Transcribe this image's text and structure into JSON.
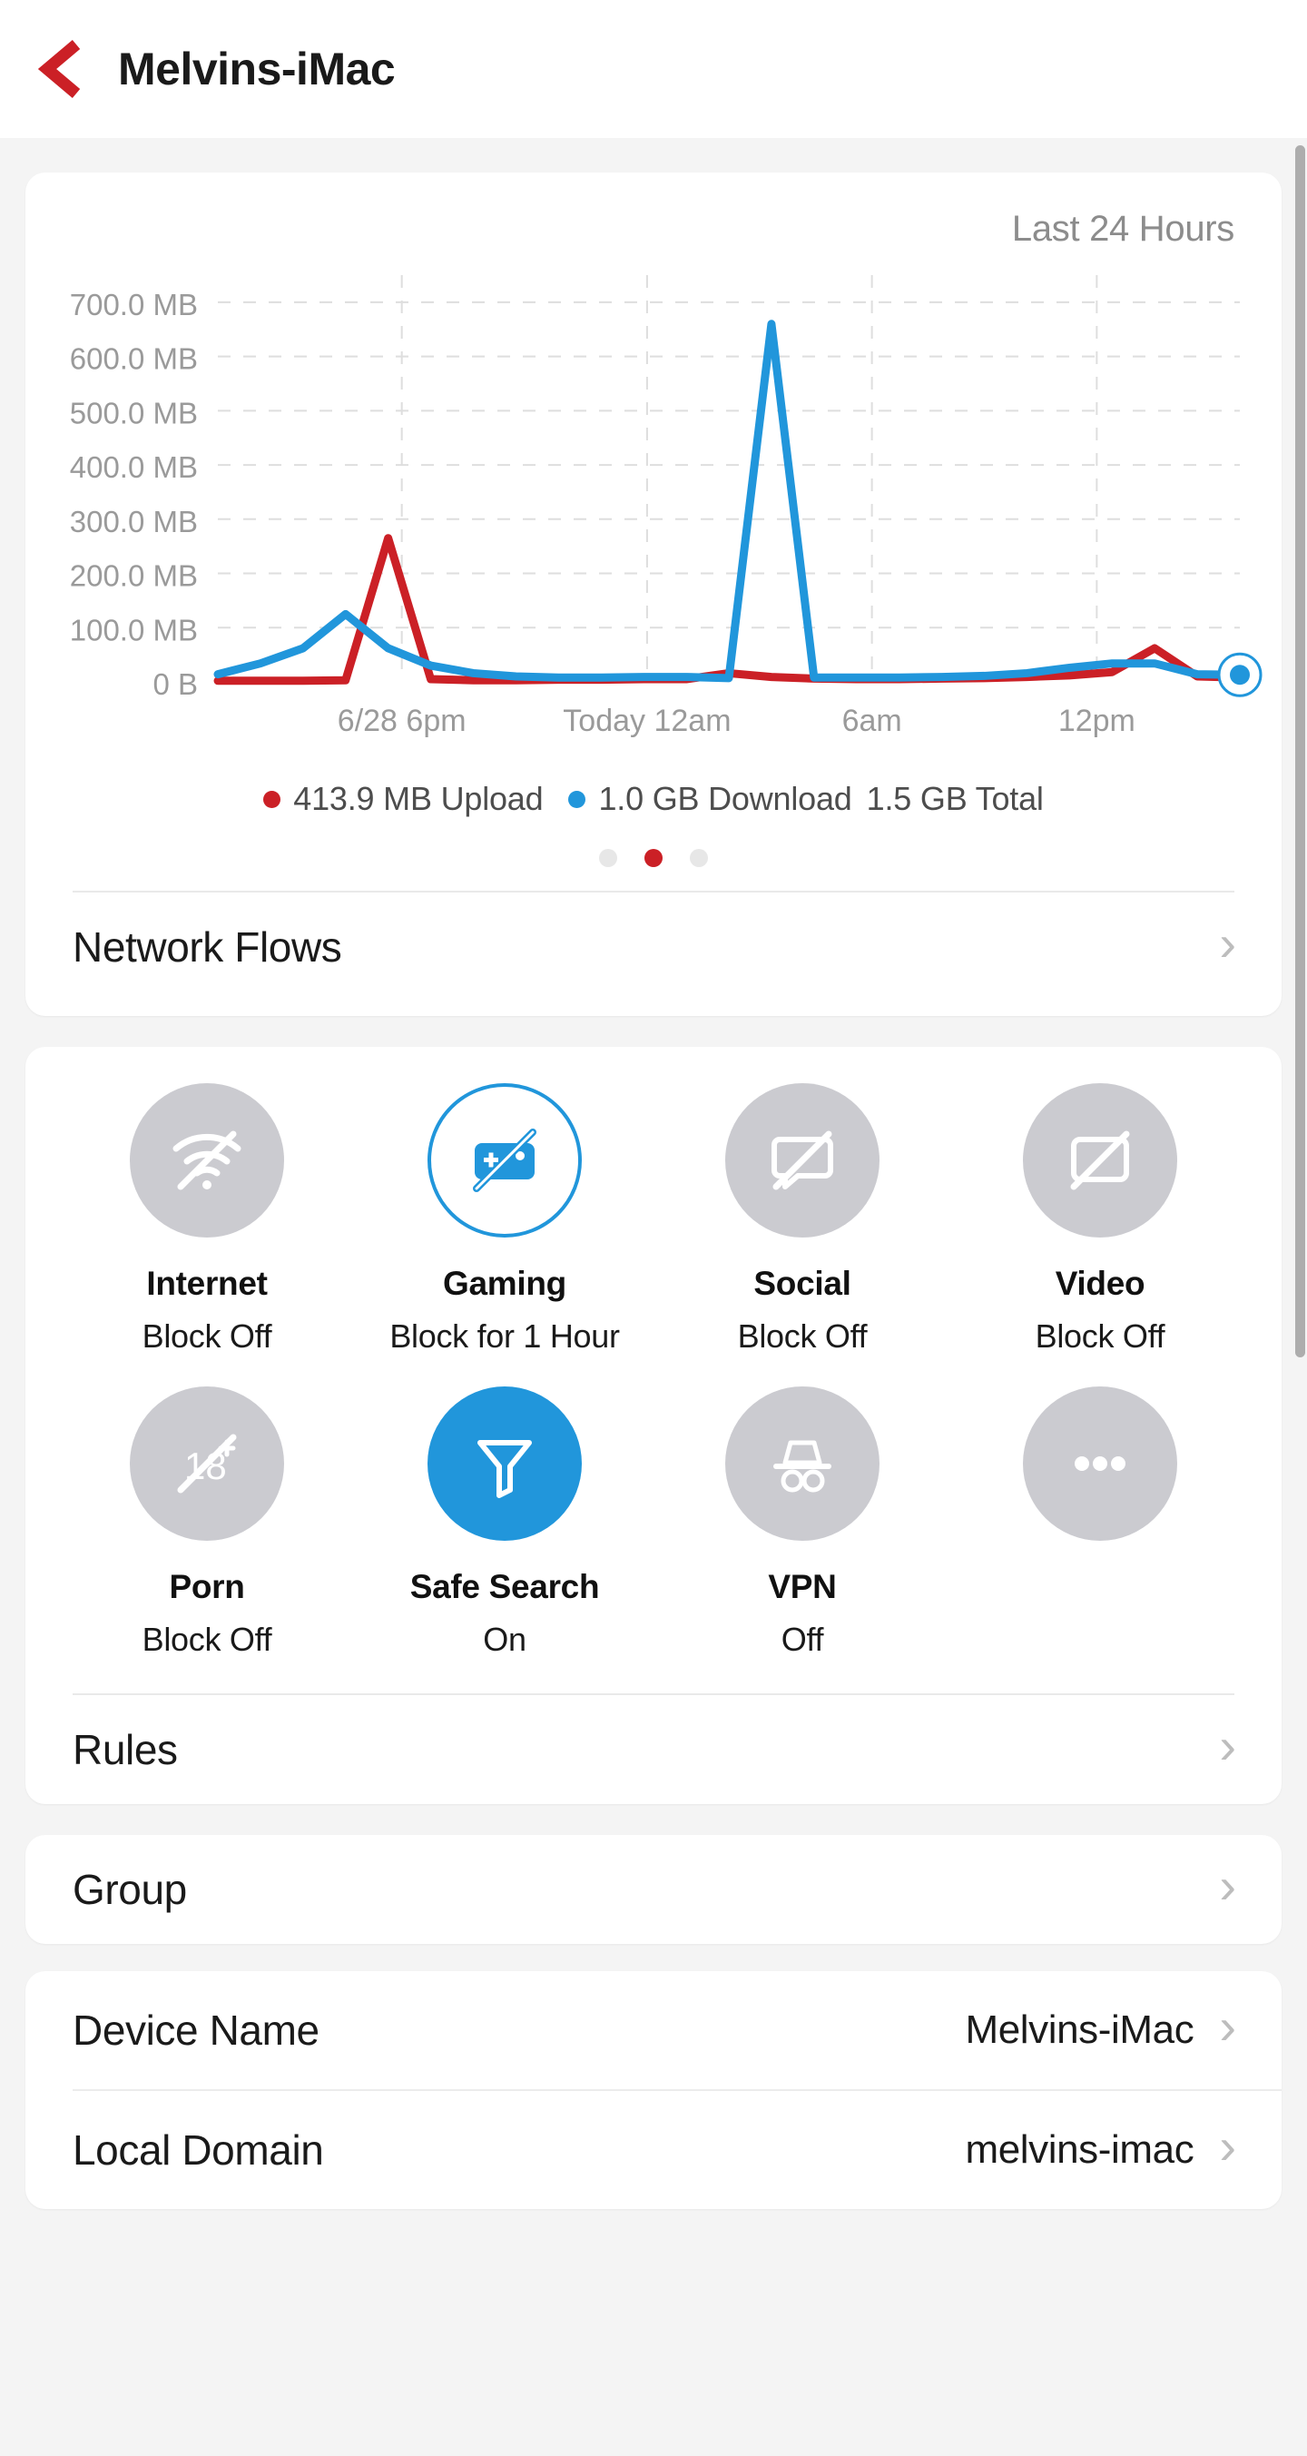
{
  "header": {
    "back_icon": "chevron-left-icon",
    "title": "Melvins-iMac",
    "accent": "#cb2026"
  },
  "chart_card": {
    "range_label": "Last 24 Hours",
    "legend": {
      "upload": "413.9 MB Upload",
      "download": "1.0 GB Download",
      "total": "1.5 GB Total",
      "upload_color": "#cb2026",
      "download_color": "#2196db"
    },
    "pager": {
      "count": 3,
      "active_index": 1
    },
    "network_flows_label": "Network Flows"
  },
  "chart_data": {
    "type": "line",
    "title": "Last 24 Hours",
    "xlabel": "",
    "ylabel": "",
    "grid": true,
    "legend_position": "bottom",
    "ylim": [
      0,
      750
    ],
    "y_unit": "MB",
    "ytick_labels": [
      "700.0 MB",
      "600.0 MB",
      "500.0 MB",
      "400.0 MB",
      "300.0 MB",
      "200.0 MB",
      "100.0 MB",
      "0 B"
    ],
    "ytick_values": [
      700,
      600,
      500,
      400,
      300,
      200,
      100,
      0
    ],
    "xtick_labels": [
      "6/28 6pm",
      "Today 12am",
      "6am",
      "12pm"
    ],
    "xtick_positions": [
      0.18,
      0.42,
      0.64,
      0.86
    ],
    "x": [
      0,
      1,
      2,
      3,
      4,
      5,
      6,
      7,
      8,
      9,
      10,
      11,
      12,
      13,
      14,
      15,
      16,
      17,
      18,
      19,
      20,
      21,
      22,
      23,
      24
    ],
    "series": [
      {
        "name": "Upload",
        "color": "#cb2026",
        "values": [
          2,
          2,
          2,
          3,
          265,
          5,
          3,
          3,
          4,
          4,
          5,
          5,
          16,
          9,
          6,
          5,
          5,
          6,
          7,
          9,
          12,
          18,
          62,
          10,
          8
        ]
      },
      {
        "name": "Download",
        "color": "#2196db",
        "values": [
          14,
          34,
          62,
          125,
          62,
          30,
          16,
          10,
          8,
          8,
          9,
          9,
          7,
          660,
          8,
          8,
          8,
          9,
          11,
          16,
          26,
          34,
          34,
          14,
          13
        ]
      }
    ],
    "end_marker": {
      "series": "Download",
      "color": "#2196db"
    }
  },
  "controls_card": {
    "items": [
      {
        "title": "Internet",
        "status": "Block Off",
        "icon": "wifi-off-icon",
        "state": "inactive"
      },
      {
        "title": "Gaming",
        "status": "Block for 1 Hour",
        "icon": "gamepad-off-icon",
        "state": "outlined"
      },
      {
        "title": "Social",
        "status": "Block Off",
        "icon": "chat-off-icon",
        "state": "inactive"
      },
      {
        "title": "Video",
        "status": "Block Off",
        "icon": "video-off-icon",
        "state": "inactive"
      },
      {
        "title": "Porn",
        "status": "Block Off",
        "icon": "adult-18-off-icon",
        "state": "inactive"
      },
      {
        "title": "Safe Search",
        "status": "On",
        "icon": "funnel-icon",
        "state": "filled"
      },
      {
        "title": "VPN",
        "status": "Off",
        "icon": "incognito-hat-icon",
        "state": "inactive"
      },
      {
        "title": "",
        "status": "",
        "icon": "more-ellipsis-icon",
        "state": "inactive"
      }
    ],
    "rules_label": "Rules"
  },
  "group_card": {
    "label": "Group"
  },
  "info_card": {
    "rows": [
      {
        "label": "Device Name",
        "value": "Melvins-iMac"
      },
      {
        "label": "Local Domain",
        "value": "melvins-imac"
      }
    ]
  },
  "icons": {
    "chevron_right": "›"
  }
}
